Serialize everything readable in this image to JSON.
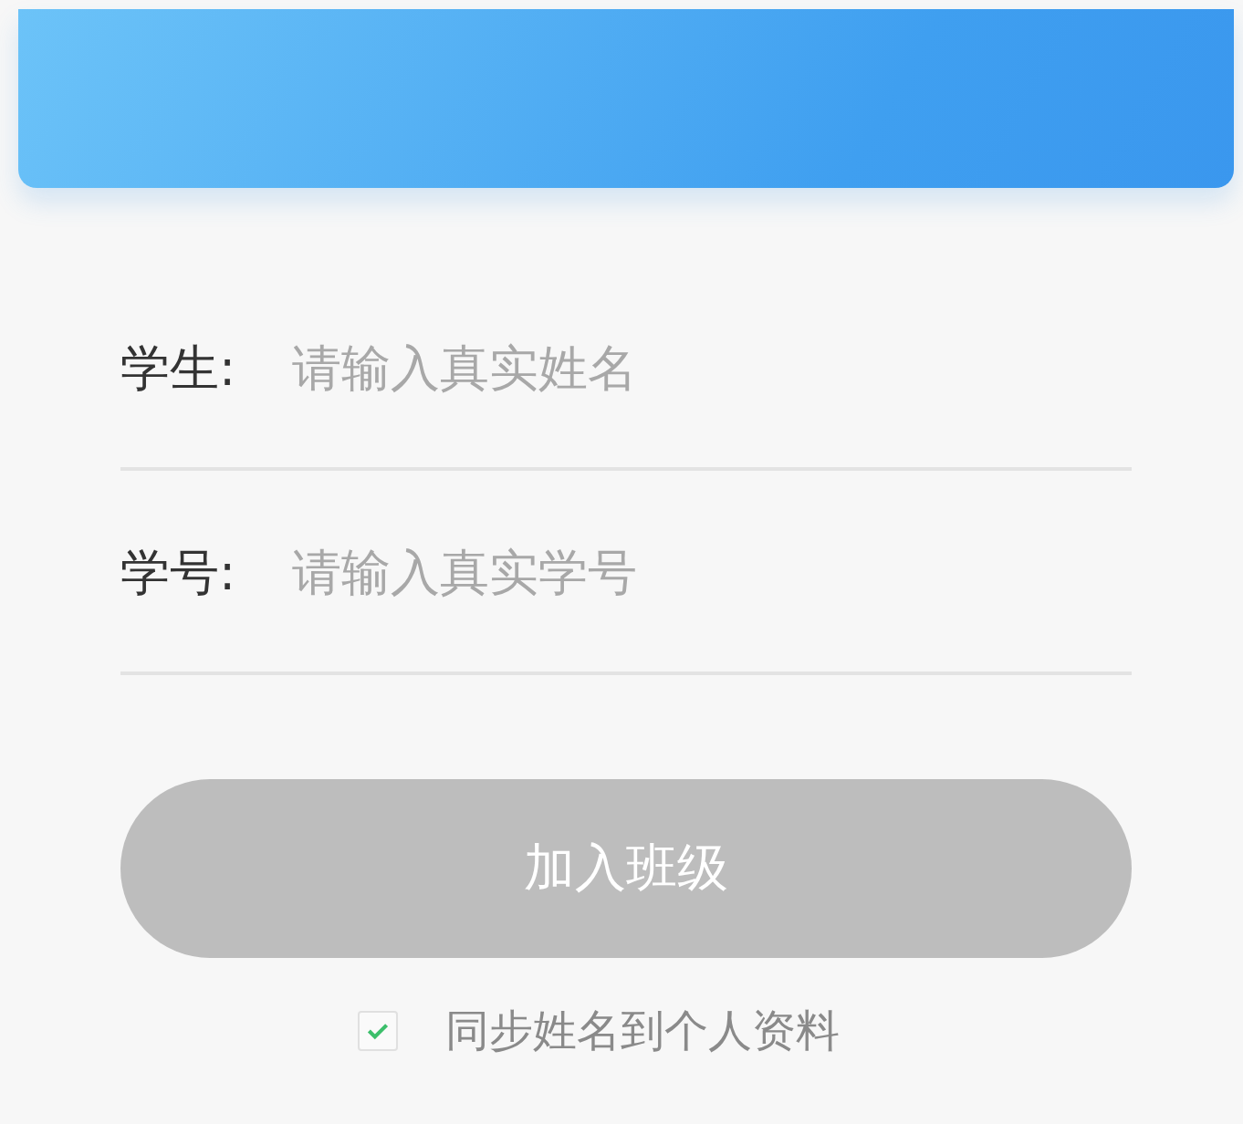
{
  "fields": [
    {
      "label": "学生:",
      "placeholder": "请输入真实姓名"
    },
    {
      "label": "学号:",
      "placeholder": "请输入真实学号"
    }
  ],
  "join_button": {
    "label": "加入班级",
    "disabled": true
  },
  "sync_option": {
    "label": "同步姓名到个人资料",
    "checked": true
  }
}
